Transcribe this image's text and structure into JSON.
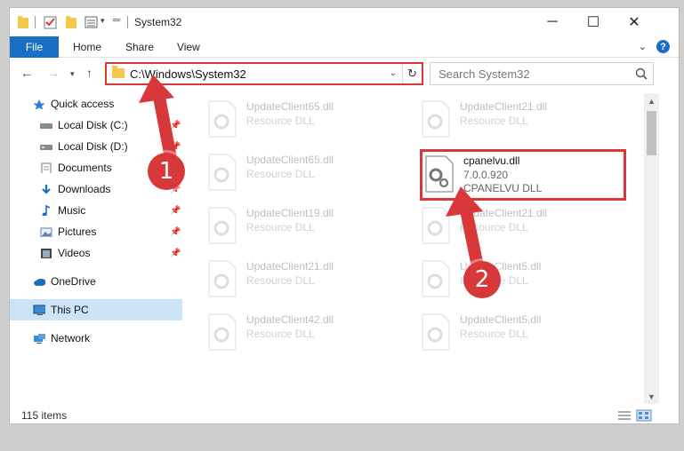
{
  "window": {
    "title": "System32"
  },
  "ribbon": {
    "tabs": [
      "File",
      "Home",
      "Share",
      "View"
    ],
    "help": "?"
  },
  "nav": {
    "address": "C:\\Windows\\System32",
    "search_placeholder": "Search System32"
  },
  "sidebar": {
    "items": [
      {
        "label": "Quick access",
        "icon": "star-icon",
        "pinned": false
      },
      {
        "label": "Local Disk (C:)",
        "icon": "drive-icon",
        "pinned": true
      },
      {
        "label": "Local Disk (D:)",
        "icon": "drive-icon",
        "pinned": true
      },
      {
        "label": "Documents",
        "icon": "documents-icon",
        "pinned": true
      },
      {
        "label": "Downloads",
        "icon": "download-icon",
        "pinned": true
      },
      {
        "label": "Music",
        "icon": "music-icon",
        "pinned": true
      },
      {
        "label": "Pictures",
        "icon": "pictures-icon",
        "pinned": true
      },
      {
        "label": "Videos",
        "icon": "videos-icon",
        "pinned": true
      },
      {
        "label": "OneDrive",
        "icon": "cloud-icon",
        "pinned": false
      },
      {
        "label": "This PC",
        "icon": "computer-icon",
        "pinned": false,
        "selected": true
      },
      {
        "label": "Network",
        "icon": "network-icon",
        "pinned": false
      }
    ]
  },
  "files": {
    "left": [
      {
        "name": "UpdateClient65.dll",
        "type": "Resource DLL"
      },
      {
        "name": "UpdateClient65.dll",
        "type": "Resource DLL"
      },
      {
        "name": "UpdateClient19.dll",
        "type": "Resource DLL"
      },
      {
        "name": "UpdateClient21.dll",
        "type": "Resource DLL"
      },
      {
        "name": "UpdateClient42.dll",
        "type": "Resource DLL"
      }
    ],
    "right": [
      {
        "name": "UpdateClient21.dll",
        "type": "Resource DLL"
      },
      {
        "name": "UpdateClient21.dll",
        "type": "Resource DLL"
      },
      {
        "name": "UpdateClient5.dll",
        "type": "Resource DLL"
      },
      {
        "name": "UpdateClient5.dll",
        "type": "Resource DLL"
      }
    ],
    "highlighted": {
      "name": "cpanelvu.dll",
      "version": "7.0.0.920",
      "description": "CPANELVU DLL"
    }
  },
  "status": {
    "item_count": "115 items"
  },
  "annotations": {
    "step1": "1",
    "step2": "2"
  },
  "colors": {
    "accent": "#1a6fc4",
    "annotation": "#d9383a",
    "selection": "#cce4f7"
  }
}
